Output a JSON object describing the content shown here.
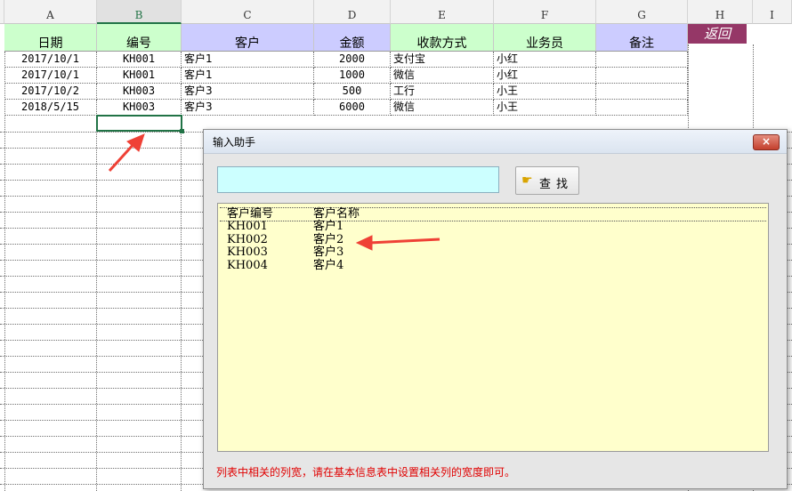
{
  "columns": [
    "A",
    "B",
    "C",
    "D",
    "E",
    "F",
    "G",
    "H",
    "I"
  ],
  "headers": [
    "日期",
    "编号",
    "客户",
    "金额",
    "收款方式",
    "业务员",
    "备注"
  ],
  "back_button": "返回",
  "rows": [
    [
      "2017/10/1",
      "KH001",
      "客户1",
      "2000",
      "支付宝",
      "小红",
      ""
    ],
    [
      "2017/10/1",
      "KH001",
      "客户1",
      "1000",
      "微信",
      "小红",
      ""
    ],
    [
      "2017/10/2",
      "KH003",
      "客户3",
      "500",
      "工行",
      "小王",
      ""
    ],
    [
      "2018/5/15",
      "KH003",
      "客户3",
      "6000",
      "微信",
      "小王",
      ""
    ]
  ],
  "dialog": {
    "title": "输入助手",
    "close_label": "×",
    "search_value": "",
    "find_label": "查找",
    "list_header": {
      "code": "客户编号",
      "name": "客户名称"
    },
    "list_items": [
      {
        "code": "KH001",
        "name": "客户1"
      },
      {
        "code": "KH002",
        "name": "客户2"
      },
      {
        "code": "KH003",
        "name": "客户3"
      },
      {
        "code": "KH004",
        "name": "客户4"
      }
    ],
    "note": "列表中相关的列宽，请在基本信息表中设置相关列的宽度即可。"
  },
  "colors": {
    "annotation_arrow": "#ef4136",
    "header_green": "#ccffcc",
    "header_purple": "#ccccff",
    "back_button": "#953767"
  }
}
